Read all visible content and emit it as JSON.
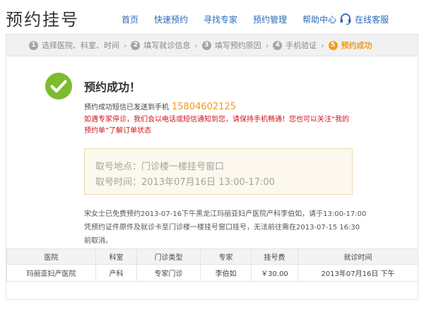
{
  "header": {
    "title": "预约挂号",
    "nav": [
      "首页",
      "快速预约",
      "寻找专家",
      "预约管理",
      "帮助中心"
    ],
    "service_label": "在线客服",
    "accent_color": "#2a6ab7"
  },
  "steps": [
    {
      "num": "1",
      "label": "选择医院、科室、时间"
    },
    {
      "num": "2",
      "label": "填写就诊信息"
    },
    {
      "num": "3",
      "label": "填写预约原因"
    },
    {
      "num": "4",
      "label": "手机验证"
    },
    {
      "num": "5",
      "label": "预约成功"
    }
  ],
  "success": {
    "title": "预约成功！",
    "sms_prefix": "预约成功短信已发送到手机",
    "phone": "15804602125",
    "warning": "如遇专家停诊，我们会以电话或短信通知到您，请保持手机畅通！您也可以关注“我的预约单”了解订单状态"
  },
  "pickup": {
    "location": "取号地点：门诊楼一楼挂号窗口",
    "time": "取号时间：2013年07月16日 13:00-17:00"
  },
  "notice": "宋女士已免费预约2013-07-16下午黑龙江玛丽亚妇产医院产科李伯如，请于13:00-17:00凭预约证件原件及就诊卡至门诊楼一楼挂号窗口挂号，无法前往需在2013-07-15 16:30前取消。",
  "table": {
    "headers": [
      "医院",
      "科室",
      "门诊类型",
      "专家",
      "挂号费",
      "就诊时间"
    ],
    "rows": [
      [
        "玛丽亚妇产医院",
        "产科",
        "专家门诊",
        "李伯如",
        "￥30.00",
        "2013年07月16日  下午"
      ]
    ]
  }
}
